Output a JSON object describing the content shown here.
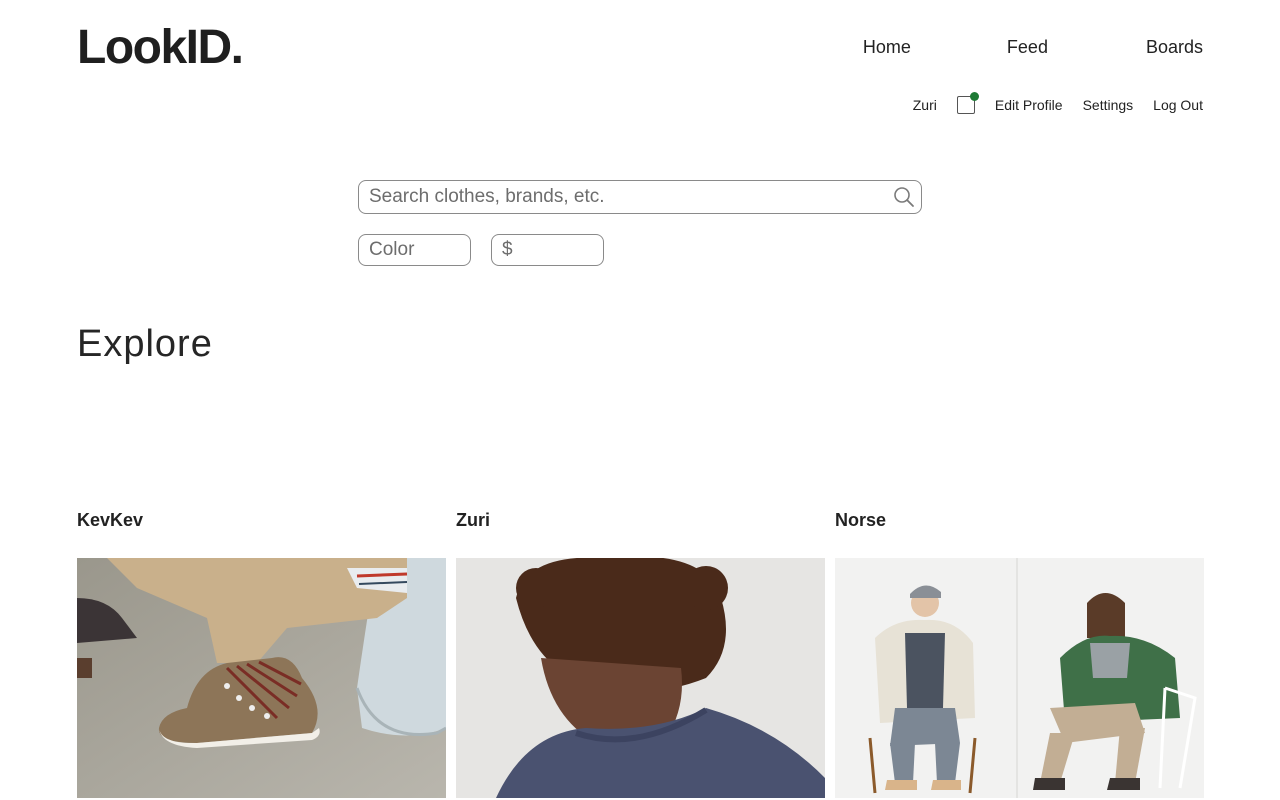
{
  "brand": {
    "logo": "LookID."
  },
  "main_nav": {
    "home": "Home",
    "feed": "Feed",
    "boards": "Boards"
  },
  "user_nav": {
    "username": "Zuri",
    "notification_icon": "inbox-icon",
    "notification_status_color": "#1e7a34",
    "edit_profile": "Edit Profile",
    "settings": "Settings",
    "log_out": "Log Out"
  },
  "search": {
    "placeholder": "Search clothes, brands, etc.",
    "value": "",
    "icon": "search-icon"
  },
  "filters": {
    "color": {
      "placeholder": "Color",
      "value": ""
    },
    "price": {
      "placeholder": "$",
      "value": ""
    }
  },
  "explore": {
    "title": "Explore",
    "cards": [
      {
        "user": "KevKev",
        "image": "boots-photo"
      },
      {
        "user": "Zuri",
        "image": "sweater-photo"
      },
      {
        "user": "Norse",
        "image": "jackets-photo"
      }
    ]
  }
}
